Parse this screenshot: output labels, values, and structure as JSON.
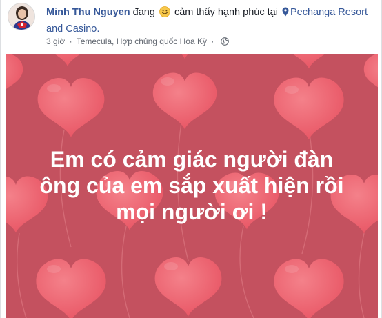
{
  "post": {
    "author": "Minh Thu Nguyen",
    "verb": "đang",
    "feeling": "cảm thấy hạnh phúc tại",
    "place": "Pechanga Resort and Casino.",
    "time": "3 giờ",
    "separator": "·",
    "location": "Temecula, Hợp chủng quốc Hoa Kỳ",
    "privacy_icon": "globe-icon",
    "feeling_icon": "smiley-emoji",
    "place_icon": "map-pin-icon"
  },
  "status": {
    "lines": [
      "Em có cảm giác người đàn",
      "ông của em sắp xuất hiện rồi",
      "mọi người ơi !"
    ],
    "background_color": "#c4515f",
    "heart_color": "#f06670",
    "text_color": "#ffffff"
  }
}
